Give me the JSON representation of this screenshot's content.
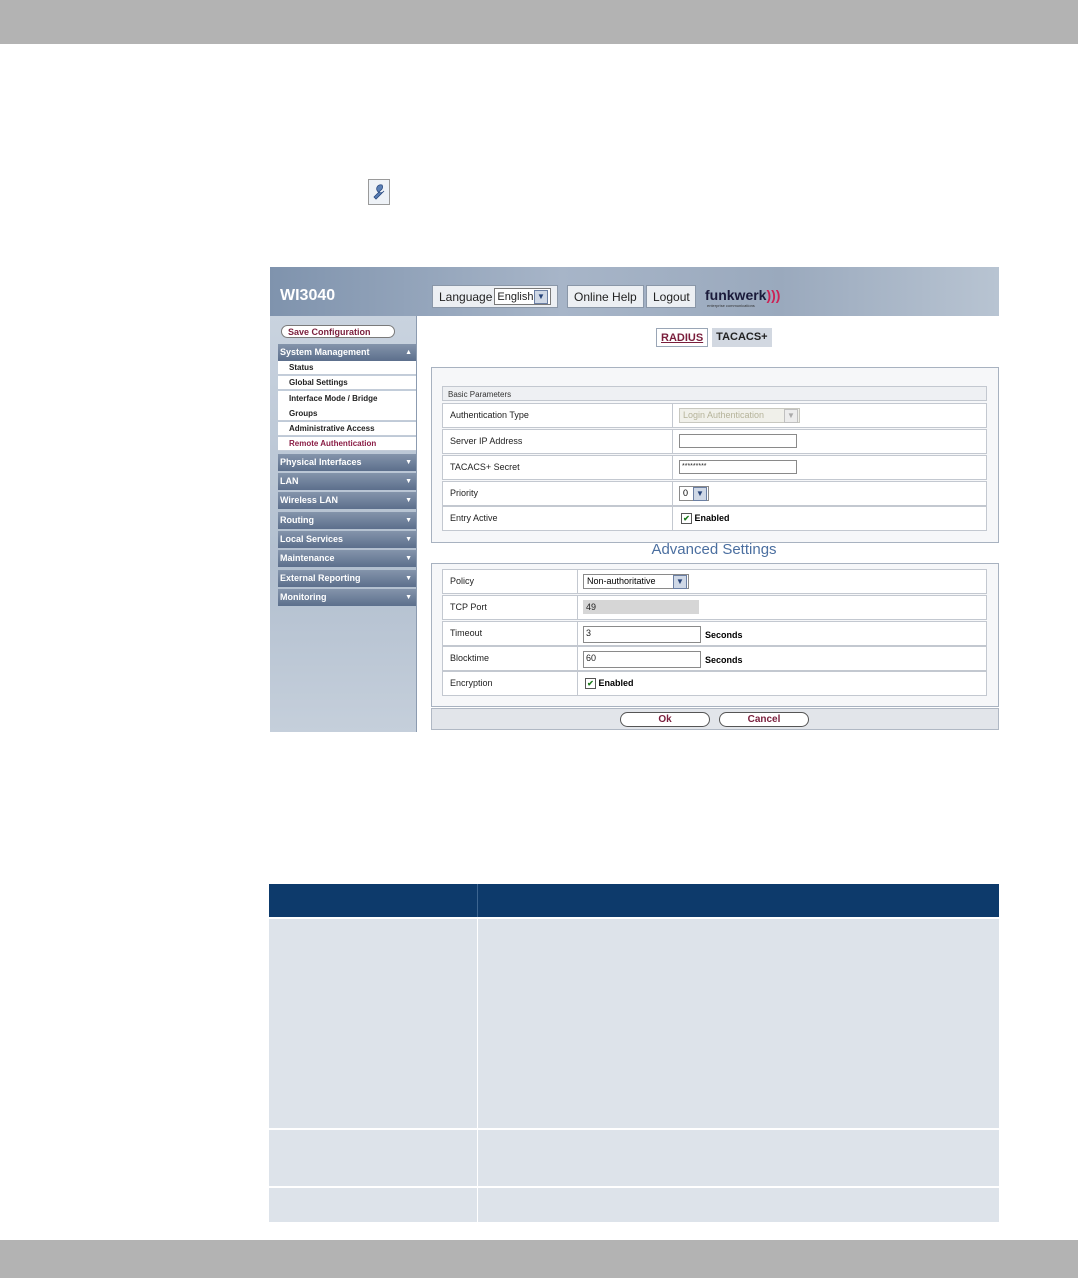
{
  "window": {
    "product": "WI3040",
    "language_label": "Language",
    "language_value": "English",
    "online_help": "Online Help",
    "logout": "Logout",
    "logo": "funkwerk",
    "logo_arcs": ")))",
    "logo_sub": "enterprise communications"
  },
  "sidebar": {
    "save_label": "Save Configuration",
    "groups": [
      {
        "label": "System Management",
        "caret": "▲"
      },
      {
        "label": "Physical Interfaces",
        "caret": "▼"
      },
      {
        "label": "LAN",
        "caret": "▼"
      },
      {
        "label": "Wireless LAN",
        "caret": "▼"
      },
      {
        "label": "Routing",
        "caret": "▼"
      },
      {
        "label": "Local Services",
        "caret": "▼"
      },
      {
        "label": "Maintenance",
        "caret": "▼"
      },
      {
        "label": "External Reporting",
        "caret": "▼"
      },
      {
        "label": "Monitoring",
        "caret": "▼"
      }
    ],
    "submenu": [
      {
        "label": "Status"
      },
      {
        "label": "Global Settings"
      },
      {
        "label": "Interface Mode / Bridge Groups"
      },
      {
        "label": "Administrative Access"
      },
      {
        "label": "Remote Authentication",
        "active": true
      }
    ],
    "submenu_line1": "Interface Mode / Bridge",
    "submenu_line2": "Groups"
  },
  "tabs": [
    "RADIUS",
    "TACACS+"
  ],
  "basic": {
    "heading": "Basic Parameters",
    "auth_type_label": "Authentication Type",
    "auth_type_value": "Login Authentication",
    "server_ip_label": "Server IP Address",
    "server_ip_value": "",
    "secret_label": "TACACS+ Secret",
    "secret_value": "*********",
    "priority_label": "Priority",
    "priority_value": "0",
    "entry_active_label": "Entry Active",
    "enabled_label": "Enabled"
  },
  "advanced": {
    "title": "Advanced Settings",
    "policy_label": "Policy",
    "policy_value": "Non-authoritative",
    "tcp_port_label": "TCP Port",
    "tcp_port_value": "49",
    "timeout_label": "Timeout",
    "timeout_value": "3",
    "blocktime_label": "Blocktime",
    "blocktime_value": "60",
    "seconds": "Seconds",
    "encryption_label": "Encryption",
    "enabled_label": "Enabled"
  },
  "buttons": {
    "ok": "Ok",
    "cancel": "Cancel"
  },
  "colors": {
    "table_header": "#0d3a6b",
    "table_row": "#dde3ea",
    "accent": "#7a1e3c",
    "gray_bar": "#b3b3b3"
  }
}
